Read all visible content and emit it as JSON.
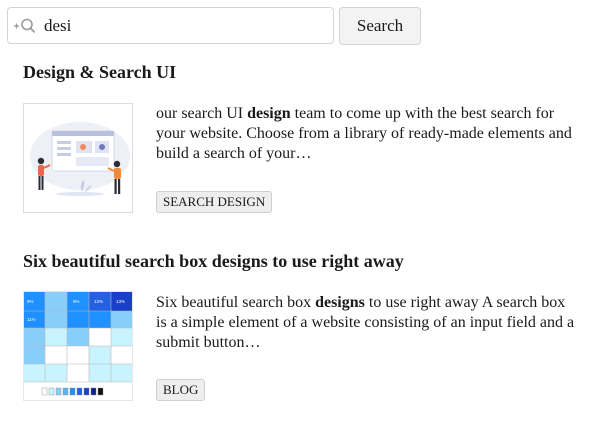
{
  "search": {
    "value": "desi",
    "button_label": "Search",
    "icon": "search-icon"
  },
  "results": [
    {
      "title": "Design & Search UI",
      "snippet_before": "our search UI ",
      "snippet_highlight": "design",
      "snippet_after": " team to come up with the best search for your website. Choose from a library of ready-made elements and build a search of your…",
      "tag": "SEARCH DESIGN",
      "thumbnail": "illustration-two-people-dashboard"
    },
    {
      "title": "Six beautiful search box designs to use right away",
      "snippet_before": "Six beautiful search box ",
      "snippet_highlight": "designs",
      "snippet_after": " to use right away A search box is a simple element of a website consisting of an input field and a submit button…",
      "tag": "BLOG",
      "thumbnail": "blue-heatmap-grid",
      "heatmap_labels": [
        "9%",
        "9%",
        "12%",
        "13%",
        "11%"
      ]
    }
  ],
  "colors": {
    "heatmap_dark": "#1a3fc8",
    "heatmap_mid": "#1e90ff",
    "heatmap_light": "#87cefa",
    "heatmap_pale": "#c9f4ff"
  }
}
